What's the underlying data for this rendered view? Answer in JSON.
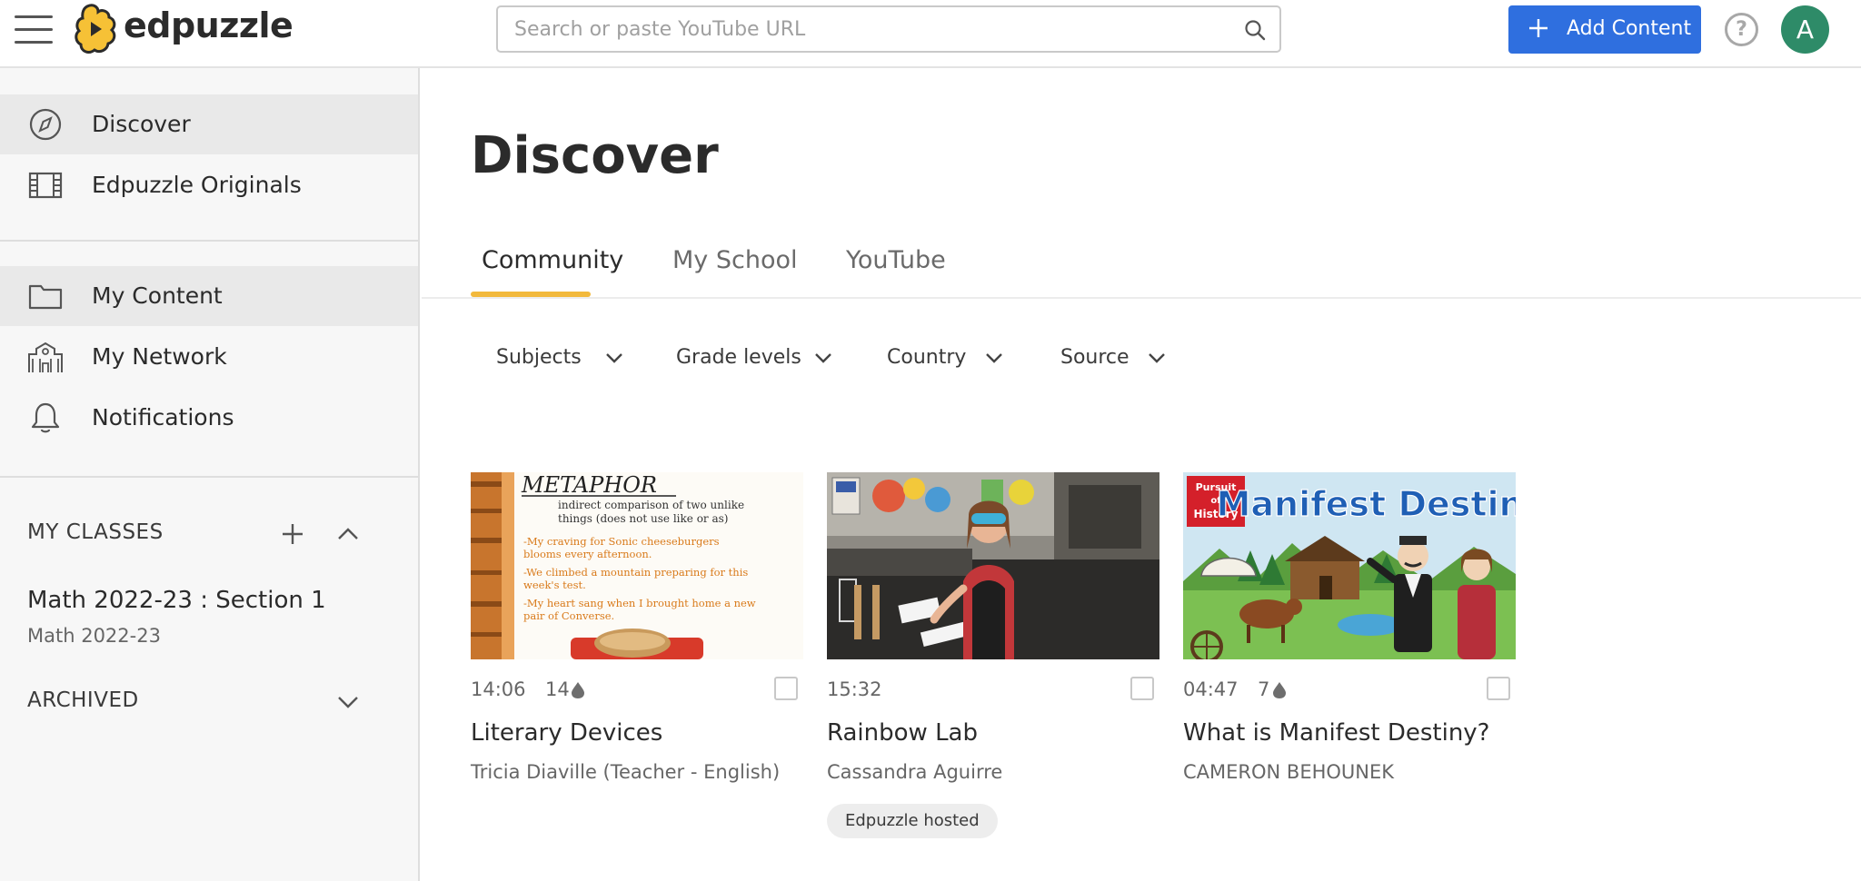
{
  "app": {
    "brand": "edpuzzle"
  },
  "search": {
    "placeholder": "Search or paste YouTube URL"
  },
  "header": {
    "add_content_label": "Add Content",
    "help_label": "?",
    "avatar_initial": "A"
  },
  "colors": {
    "accent_blue": "#2f6fdf",
    "accent_yellow": "#f2b93c",
    "avatar_green": "#2e8b68"
  },
  "sidebar": {
    "top_items": [
      {
        "label": "Discover",
        "icon": "compass-icon",
        "active": true
      },
      {
        "label": "Edpuzzle Originals",
        "icon": "film-icon",
        "active": false
      }
    ],
    "content_items": [
      {
        "label": "My Content",
        "icon": "folder-icon",
        "active": true
      },
      {
        "label": "My Network",
        "icon": "school-icon",
        "active": false
      },
      {
        "label": "Notifications",
        "icon": "bell-icon",
        "active": false
      }
    ],
    "my_classes_title": "MY CLASSES",
    "classes": [
      {
        "name": "Math 2022-23 : Section 1",
        "subtitle": "Math 2022-23"
      }
    ],
    "archived_title": "ARCHIVED"
  },
  "main": {
    "title": "Discover",
    "tabs": [
      {
        "label": "Community",
        "active": true
      },
      {
        "label": "My School",
        "active": false
      },
      {
        "label": "YouTube",
        "active": false
      }
    ],
    "filters": [
      {
        "label": "Subjects"
      },
      {
        "label": "Grade levels"
      },
      {
        "label": "Country"
      },
      {
        "label": "Source"
      }
    ],
    "videos": [
      {
        "duration": "14:06",
        "questions": "14",
        "title": "Literary Devices",
        "author": "Tricia Diaville (Teacher - English)",
        "thumb": {
          "heading": "METAPHOR",
          "definition_1": "indirect comparison of two unlike",
          "definition_2": "things (does not use like or as)",
          "ex1_1": "-My craving for Sonic cheeseburgers",
          "ex1_2": "blooms every afternoon.",
          "ex2_1": "-We climbed a mountain preparing for this",
          "ex2_2": "week's test.",
          "ex3_1": "-My heart sang when I brought home a new",
          "ex3_2": "pair of Converse."
        }
      },
      {
        "duration": "15:32",
        "title": "Rainbow Lab",
        "author": "Cassandra Aguirre",
        "badge": "Edpuzzle hosted"
      },
      {
        "duration": "04:47",
        "questions": "7",
        "title": "What is Manifest Destiny?",
        "author": "CAMERON BEHOUNEK",
        "thumb": {
          "badge_1": "Pursuit",
          "badge_2": "of",
          "badge_3": "History",
          "heading": "Manifest Destiny"
        }
      }
    ]
  }
}
